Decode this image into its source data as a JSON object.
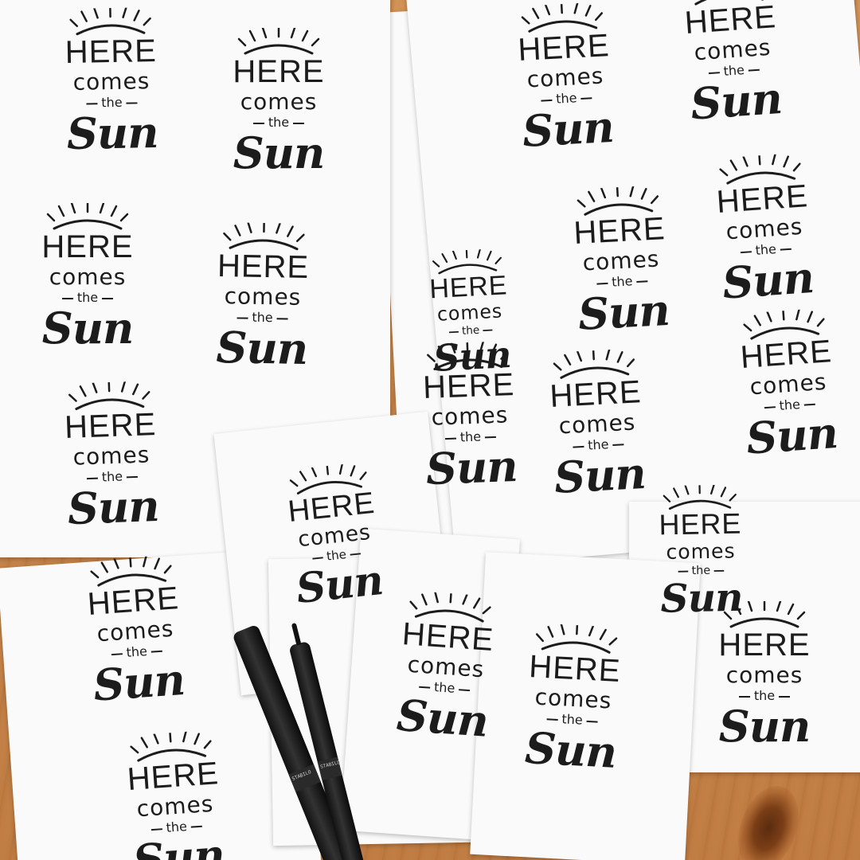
{
  "lettering": {
    "line1": "HERE",
    "line2": "comes",
    "line3": "the",
    "line4": "Sun"
  },
  "pens": [
    {
      "band_text": "STABILO"
    },
    {
      "band_text": "STABILO"
    }
  ],
  "colors": {
    "table_wood": "#c98b52",
    "paper": "#fafafa",
    "ink": "#1c1c1c"
  }
}
